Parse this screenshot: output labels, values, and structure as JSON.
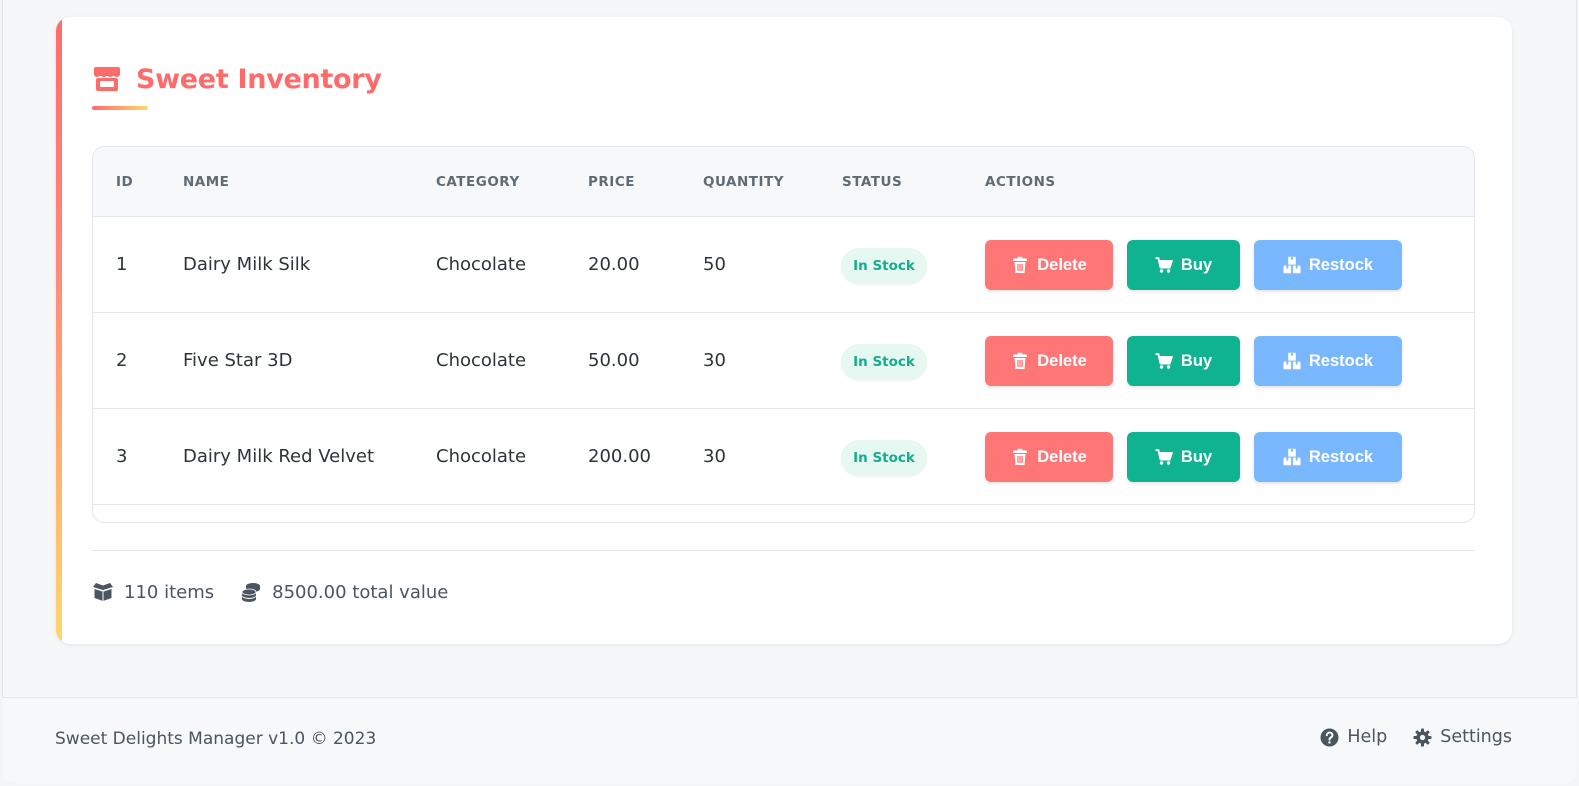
{
  "title": "Sweet Inventory",
  "colors": {
    "accent": "#ff6b6b",
    "accent_secondary": "#ffd86b",
    "in_stock_text": "#12b089",
    "in_stock_bg": "#e7f7f2",
    "delete_button": "#ff7676",
    "buy_button": "#0fb38f",
    "restock_button": "#79b8ff",
    "page_background": "#f6f7f8",
    "card_background": "#ffffff"
  },
  "table": {
    "headers": {
      "id": "ID",
      "name": "NAME",
      "category": "CATEGORY",
      "price": "PRICE",
      "quantity": "QUANTITY",
      "status": "STATUS",
      "actions": "ACTIONS"
    },
    "rows": [
      {
        "id": "1",
        "name": "Dairy Milk Silk",
        "category": "Chocolate",
        "price": "20.00",
        "quantity": "50",
        "status": "In Stock"
      },
      {
        "id": "2",
        "name": "Five Star 3D",
        "category": "Chocolate",
        "price": "50.00",
        "quantity": "30",
        "status": "In Stock"
      },
      {
        "id": "3",
        "name": "Dairy Milk Red Velvet",
        "category": "Chocolate",
        "price": "200.00",
        "quantity": "30",
        "status": "In Stock"
      }
    ],
    "actions": {
      "delete_label": "Delete",
      "buy_label": "Buy",
      "restock_label": "Restock"
    }
  },
  "stats": {
    "items": "110 items",
    "total_value": "8500.00 total value"
  },
  "footer": {
    "copyright": "Sweet Delights Manager v1.0 © 2023",
    "help_label": "Help",
    "settings_label": "Settings"
  },
  "icons": {
    "title": "store-icon",
    "delete": "trash-icon",
    "buy": "cart-icon",
    "restock": "boxes-icon",
    "items": "box-open-icon",
    "total_value": "coins-icon",
    "help": "question-circle-icon",
    "settings": "gear-icon"
  }
}
